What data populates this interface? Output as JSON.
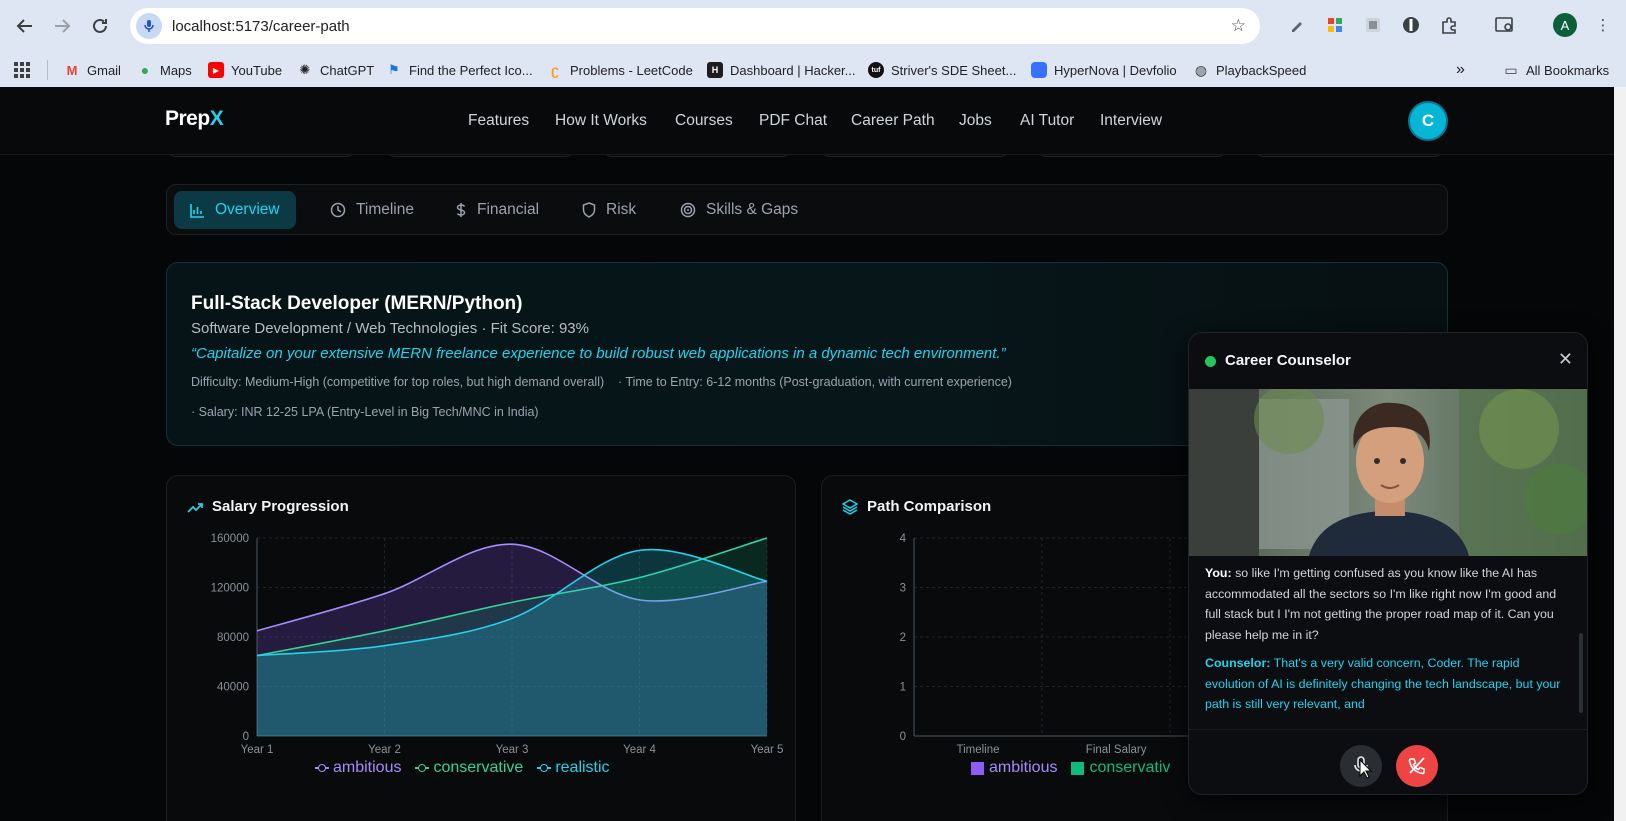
{
  "browser": {
    "url": "localhost:5173/career-path",
    "bookmarks": [
      "Gmail",
      "Maps",
      "YouTube",
      "ChatGPT",
      "Find the Perfect Ico...",
      "Problems - LeetCode",
      "Dashboard | Hacker...",
      "Striver's SDE Sheet...",
      "HyperNova | Devfolio",
      "PlaybackSpeed"
    ],
    "all_bookmarks": "All Bookmarks",
    "profile_initial": "A"
  },
  "app": {
    "logo_main": "Prep",
    "logo_accent": "X",
    "nav": [
      "Features",
      "How It Works",
      "Courses",
      "PDF Chat",
      "Career Path",
      "Jobs",
      "AI Tutor",
      "Interview"
    ],
    "avatar_initial": "C",
    "accent_color": "#22d3ee"
  },
  "tabs": [
    "Overview",
    "Timeline",
    "Financial",
    "Risk",
    "Skills & Gaps"
  ],
  "career": {
    "title": "Full-Stack Developer (MERN/Python)",
    "subtitle": "Software Development / Web Technologies · Fit Score: 93%",
    "quote": "“Capitalize on your extensive MERN freelance experience to build robust web applications in a dynamic tech environment.”",
    "meta_line1": "Difficulty: Medium-High (competitive for top roles, but high demand overall)    · Time to Entry: 6-12 months (Post-graduation, with current experience)",
    "meta_line2": "· Salary: INR 12-25 LPA (Entry-Level in Big Tech/MNC in India)"
  },
  "salary_panel": {
    "title": "Salary Progression"
  },
  "path_panel": {
    "title": "Path Comparison"
  },
  "chart_data": [
    {
      "type": "area",
      "title": "Salary Progression",
      "categories": [
        "Year 1",
        "Year 2",
        "Year 3",
        "Year 4",
        "Year 5"
      ],
      "ylim": [
        0,
        160000
      ],
      "yticks": [
        0,
        40000,
        80000,
        120000,
        160000
      ],
      "grid": true,
      "legend": "bottom",
      "series": [
        {
          "name": "ambitious",
          "color": "#a78bfa",
          "values": [
            85000,
            115000,
            155000,
            110000,
            125000
          ]
        },
        {
          "name": "conservative",
          "color": "#34d399",
          "values": [
            65000,
            85000,
            108000,
            128000,
            160000
          ]
        },
        {
          "name": "realistic",
          "color": "#22d3ee",
          "values": [
            65000,
            73000,
            95000,
            150000,
            125000
          ]
        }
      ]
    },
    {
      "type": "bar",
      "title": "Path Comparison",
      "categories": [
        "Timeline",
        "Final Salary"
      ],
      "ylim": [
        0,
        4
      ],
      "yticks": [
        0,
        1,
        2,
        3,
        4
      ],
      "grid": true,
      "legend": "bottom",
      "series": [
        {
          "name": "ambitious",
          "color": "#a78bfa",
          "values": []
        },
        {
          "name": "conservativ",
          "color": "#10b981",
          "values": []
        }
      ]
    }
  ],
  "counselor": {
    "title": "Career Counselor",
    "close": "✕",
    "user_label": "You:",
    "user_message": "so like I'm getting confused as you know like the AI has accommodated all the sectors so I'm like right now I'm good and full stack but I I'm not getting the proper road map of it. Can you please help me in it?",
    "counselor_label": "Counselor:",
    "counselor_message": "That's a very valid concern, Coder. The rapid evolution of AI is definitely changing the tech landscape, but your path is still very relevant, and"
  }
}
